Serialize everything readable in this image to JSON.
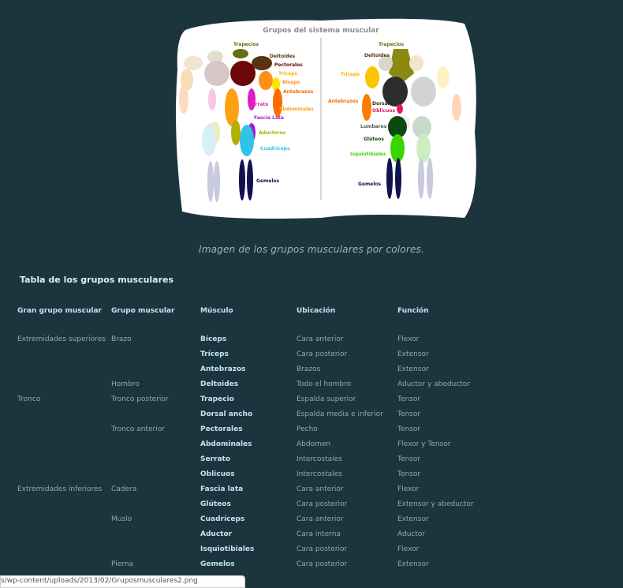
{
  "figure": {
    "title": "Grupos del sistema muscular",
    "front_labels": [
      "Trapecios",
      "Deltoides",
      "Pectorales",
      "Tríceps",
      "Bíceps",
      "Antebrazos",
      "Serrato",
      "Abdominales",
      "Fascia Lata",
      "Aductores",
      "Cuadríceps",
      "Gemelos"
    ],
    "back_labels": [
      "Trapecios",
      "Deltoides",
      "Tríceps",
      "Antebrazos",
      "Dorsales",
      "Oblicuos",
      "Lumbares",
      "Glúteos",
      "Isquiotibiales",
      "Gemelos"
    ]
  },
  "caption": "Imagen de los grupos musculares por colores.",
  "section_title": "Tabla de los grupos musculares",
  "table": {
    "headers": [
      "Gran grupo muscular",
      "Grupo muscular",
      "Músculo",
      "Ubicación",
      "Función"
    ],
    "rows": [
      [
        "Extremidades superiores",
        "Brazo",
        "Bíceps",
        "Cara anterior",
        "Flexor"
      ],
      [
        "",
        "",
        "Tríceps",
        "Cara posterior",
        "Extensor"
      ],
      [
        "",
        "",
        "Antebrazos",
        "Brazos",
        "Extensor"
      ],
      [
        "",
        "Hombro",
        "Deltoides",
        "Todo el hombro",
        "Aductor y abeductor"
      ],
      [
        "Tronco",
        "Tronco posterior",
        "Trapecio",
        "Espalda superior",
        "Tensor"
      ],
      [
        "",
        "",
        "Dorsal ancho",
        "Espalda media e inferior",
        "Tensor"
      ],
      [
        "",
        "Tronco anterior",
        "Pectorales",
        "Pecho",
        "Tensor"
      ],
      [
        "",
        "",
        "Abdominales",
        "Abdomen",
        "Flexor y Tensor"
      ],
      [
        "",
        "",
        "Serrato",
        "Intercostales",
        "Tensor"
      ],
      [
        "",
        "",
        "Oblicuos",
        "Intercostales",
        "Tensor"
      ],
      [
        "Extremidades inferiores",
        "Cadera",
        "Fascia lata",
        "Cara anterior",
        "Flexor"
      ],
      [
        "",
        "",
        "Glúteos",
        "Cara posterior",
        "Extensor y abeductor"
      ],
      [
        "",
        "Muslo",
        "Cuadríceps",
        "Cara anterior",
        "Extensor"
      ],
      [
        "",
        "",
        "Aductor",
        "Cara interna",
        "Aductor"
      ],
      [
        "",
        "",
        "Isquiotibiales",
        "Cara posterior",
        "Flexor"
      ],
      [
        "",
        "Pierna",
        "Gemelos",
        "Cara posterior",
        "Extensor"
      ]
    ]
  },
  "status_url": "s/wp-content/uploads/2013/02/Gruposmusculares2.png"
}
